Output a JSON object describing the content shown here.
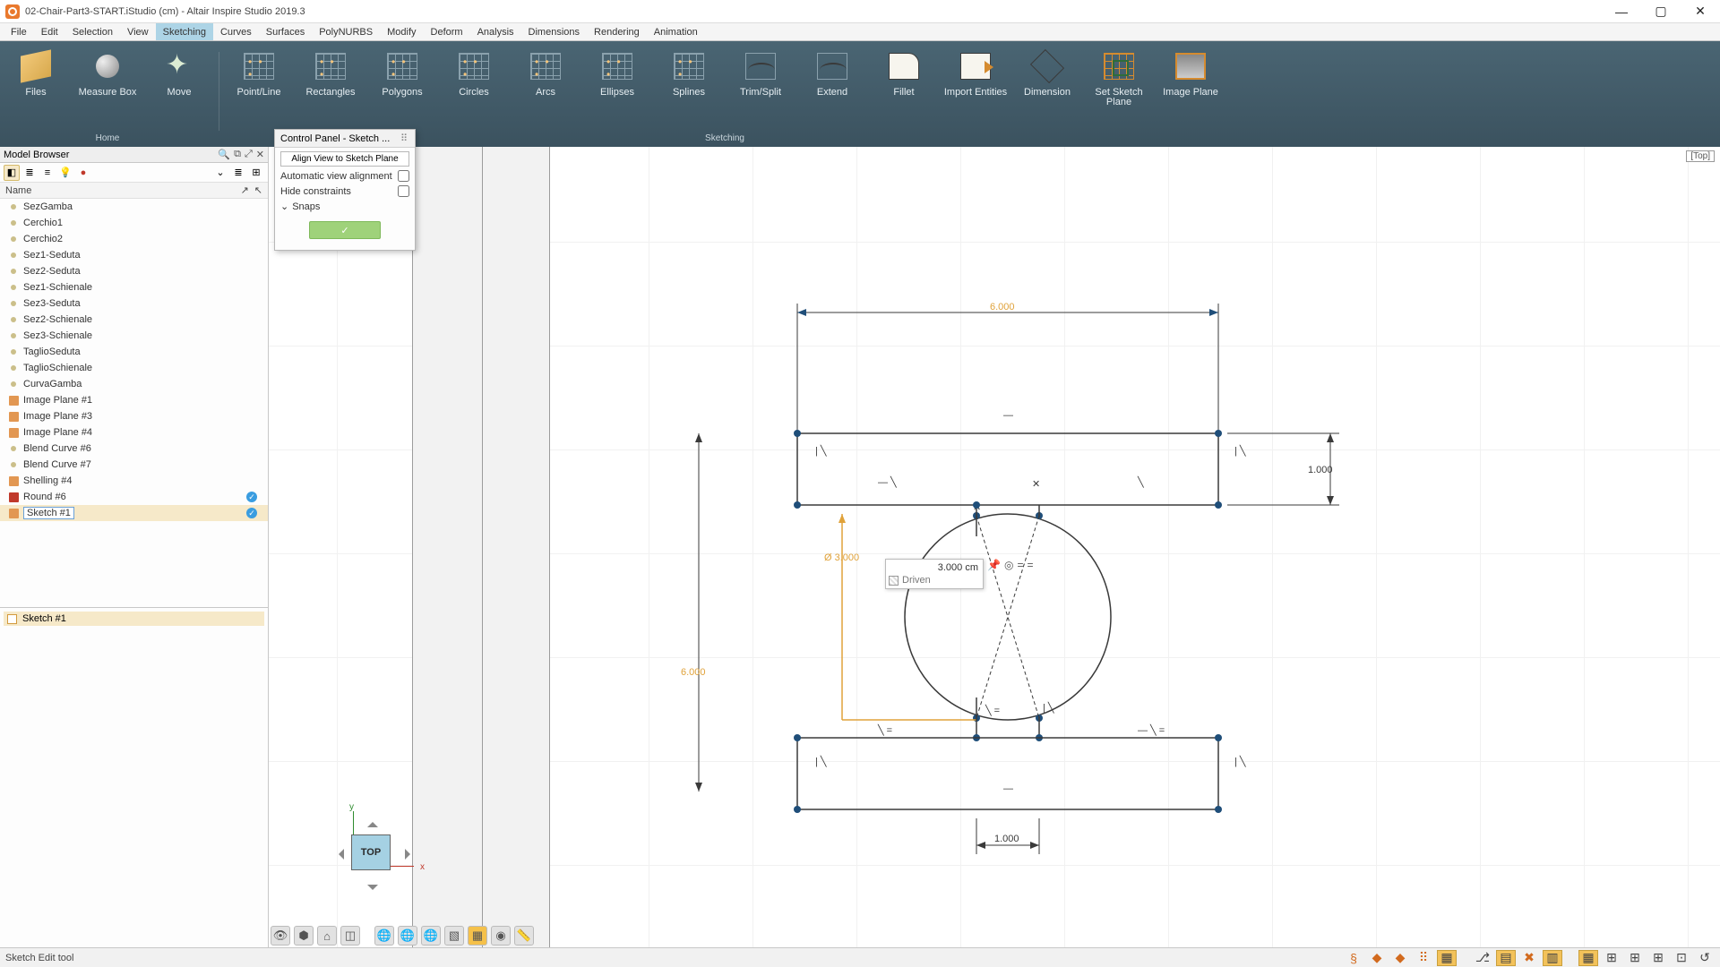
{
  "window": {
    "title": "02-Chair-Part3-START.iStudio (cm) - Altair Inspire Studio 2019.3",
    "min": "—",
    "max": "▢",
    "close": "✕"
  },
  "menu": {
    "items": [
      "File",
      "Edit",
      "Selection",
      "View",
      "Sketching",
      "Curves",
      "Surfaces",
      "PolyNURBS",
      "Modify",
      "Deform",
      "Analysis",
      "Dimensions",
      "Rendering",
      "Animation"
    ],
    "active": "Sketching"
  },
  "ribbon": {
    "groups": [
      {
        "label": "Home",
        "tools": [
          {
            "name": "files",
            "label": "Files",
            "icon": "ic-box3d"
          },
          {
            "name": "measure-box",
            "label": "Measure Box",
            "icon": "ic-meas"
          },
          {
            "name": "move",
            "label": "Move",
            "icon": "ic-move"
          }
        ]
      },
      {
        "label": "Sketching",
        "tools": [
          {
            "name": "point-line",
            "label": "Point/Line",
            "icon": "ic-grid dots"
          },
          {
            "name": "rectangles",
            "label": "Rectangles",
            "icon": "ic-grid dots"
          },
          {
            "name": "polygons",
            "label": "Polygons",
            "icon": "ic-grid dots"
          },
          {
            "name": "circles",
            "label": "Circles",
            "icon": "ic-grid dots"
          },
          {
            "name": "arcs",
            "label": "Arcs",
            "icon": "ic-grid dots"
          },
          {
            "name": "ellipses",
            "label": "Ellipses",
            "icon": "ic-grid dots"
          },
          {
            "name": "splines",
            "label": "Splines",
            "icon": "ic-grid dots"
          },
          {
            "name": "trim-split",
            "label": "Trim/Split",
            "icon": "ic-curve"
          },
          {
            "name": "extend",
            "label": "Extend",
            "icon": "ic-curve"
          },
          {
            "name": "fillet",
            "label": "Fillet",
            "icon": "ic-fillet"
          },
          {
            "name": "import-entities",
            "label": "Import Entities",
            "icon": "ic-import"
          },
          {
            "name": "dimension",
            "label": "Dimension",
            "icon": "ic-dim"
          },
          {
            "name": "set-sketch-plane",
            "label": "Set Sketch\nPlane",
            "icon": "ic-setplane"
          },
          {
            "name": "image-plane",
            "label": "Image Plane",
            "icon": "ic-imgplane"
          }
        ]
      }
    ]
  },
  "browser": {
    "title": "Model Browser",
    "name_header": "Name",
    "items": [
      {
        "label": "SezGamba",
        "type": "dot"
      },
      {
        "label": "Cerchio1",
        "type": "dot"
      },
      {
        "label": "Cerchio2",
        "type": "dot"
      },
      {
        "label": "Sez1-Seduta",
        "type": "dot"
      },
      {
        "label": "Sez2-Seduta",
        "type": "dot"
      },
      {
        "label": "Sez1-Schienale",
        "type": "dot"
      },
      {
        "label": "Sez3-Seduta",
        "type": "dot"
      },
      {
        "label": "Sez2-Schienale",
        "type": "dot"
      },
      {
        "label": "Sez3-Schienale",
        "type": "dot"
      },
      {
        "label": "TaglioSeduta",
        "type": "dot"
      },
      {
        "label": "TaglioSchienale",
        "type": "dot"
      },
      {
        "label": "CurvaGamba",
        "type": "dot"
      },
      {
        "label": "Image Plane #1",
        "type": "ico"
      },
      {
        "label": "Image Plane #3",
        "type": "ico"
      },
      {
        "label": "Image Plane #4",
        "type": "ico"
      },
      {
        "label": "Blend Curve #6",
        "type": "dot"
      },
      {
        "label": "Blend Curve #7",
        "type": "dot"
      },
      {
        "label": "Shelling #4",
        "type": "ico"
      },
      {
        "label": "Round #6",
        "type": "ico-red",
        "check": true
      },
      {
        "label": "Sketch #1",
        "type": "ico",
        "check": true,
        "selected": true
      }
    ],
    "sub_selected": "Sketch #1"
  },
  "controlPanel": {
    "title": "Control Panel - Sketch ...",
    "align_btn": "Align View to Sketch Plane",
    "auto_align": "Automatic view alignment",
    "hide_constraints": "Hide constraints",
    "snaps": "Snaps",
    "commit": "✓"
  },
  "canvas": {
    "view_tag": "[Top]",
    "navcube_face": "TOP",
    "dim_top": "6.000",
    "dim_right": "1.000",
    "dim_left": "6.000",
    "dim_diameter": "Ø 3.000",
    "dim_bottom": "1.000",
    "popup_value": "3.000 cm",
    "popup_driven": "Driven"
  },
  "status": {
    "text": "Sketch Edit tool"
  }
}
